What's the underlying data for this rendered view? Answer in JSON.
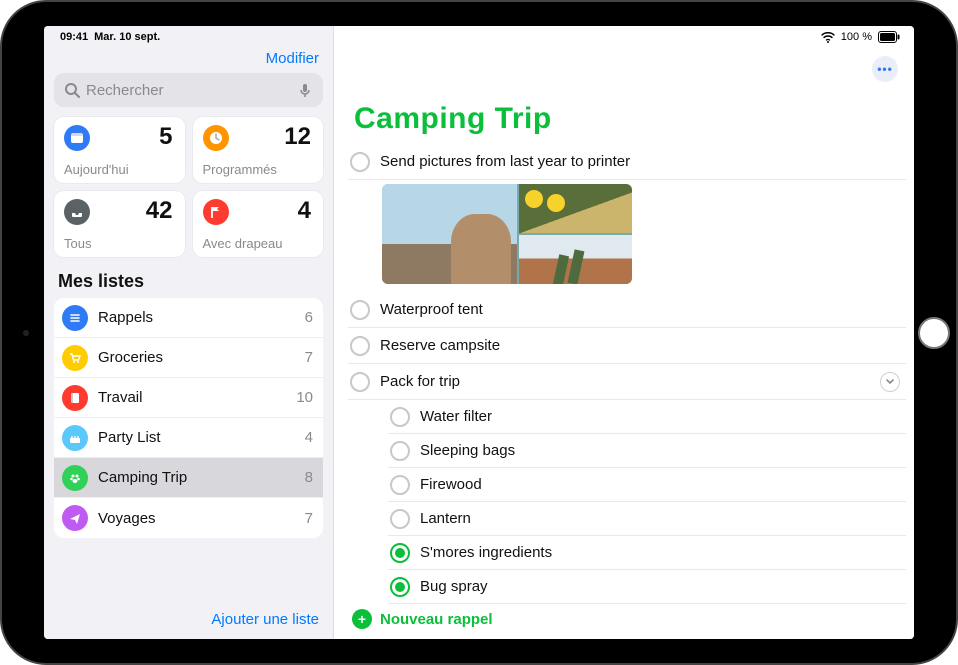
{
  "status_bar": {
    "time": "09:41",
    "date": "Mar. 10 sept.",
    "battery": "100 %"
  },
  "sidebar": {
    "edit_label": "Modifier",
    "search_placeholder": "Rechercher",
    "smart": {
      "today": {
        "label": "Aujourd'hui",
        "count": 5,
        "color": "#2f7bf5"
      },
      "scheduled": {
        "label": "Programmés",
        "count": 12,
        "color": "#ff9500"
      },
      "all": {
        "label": "Tous",
        "count": 42,
        "color": "#5b6266"
      },
      "flagged": {
        "label": "Avec drapeau",
        "count": 4,
        "color": "#ff3b30"
      }
    },
    "section_title": "Mes listes",
    "lists": [
      {
        "name": "Rappels",
        "count": 6,
        "color": "#2f7bf5",
        "icon": "list",
        "active": false
      },
      {
        "name": "Groceries",
        "count": 7,
        "color": "#ffcc00",
        "icon": "cart",
        "active": false
      },
      {
        "name": "Travail",
        "count": 10,
        "color": "#ff3b30",
        "icon": "book",
        "active": false
      },
      {
        "name": "Party List",
        "count": 4,
        "color": "#5ac8fa",
        "icon": "cake",
        "active": false
      },
      {
        "name": "Camping Trip",
        "count": 8,
        "color": "#30d158",
        "icon": "paw",
        "active": true
      },
      {
        "name": "Voyages",
        "count": 7,
        "color": "#bf5af2",
        "icon": "plane",
        "active": false
      }
    ],
    "add_list_label": "Ajouter une liste"
  },
  "detail": {
    "list_title": "Camping Trip",
    "accent": "#0bbf3b",
    "items": [
      {
        "text": "Send pictures from last year to printer",
        "done": false,
        "has_thumbs": true
      },
      {
        "text": "Waterproof tent",
        "done": false
      },
      {
        "text": "Reserve campsite",
        "done": false
      },
      {
        "text": "Pack for trip",
        "done": false,
        "expandable": true,
        "sub": [
          {
            "text": "Water filter",
            "done": false
          },
          {
            "text": "Sleeping bags",
            "done": false
          },
          {
            "text": "Firewood",
            "done": false
          },
          {
            "text": "Lantern",
            "done": false
          },
          {
            "text": "S'mores ingredients",
            "done": true
          },
          {
            "text": "Bug spray",
            "done": true
          }
        ]
      }
    ],
    "new_reminder_label": "Nouveau rappel"
  }
}
